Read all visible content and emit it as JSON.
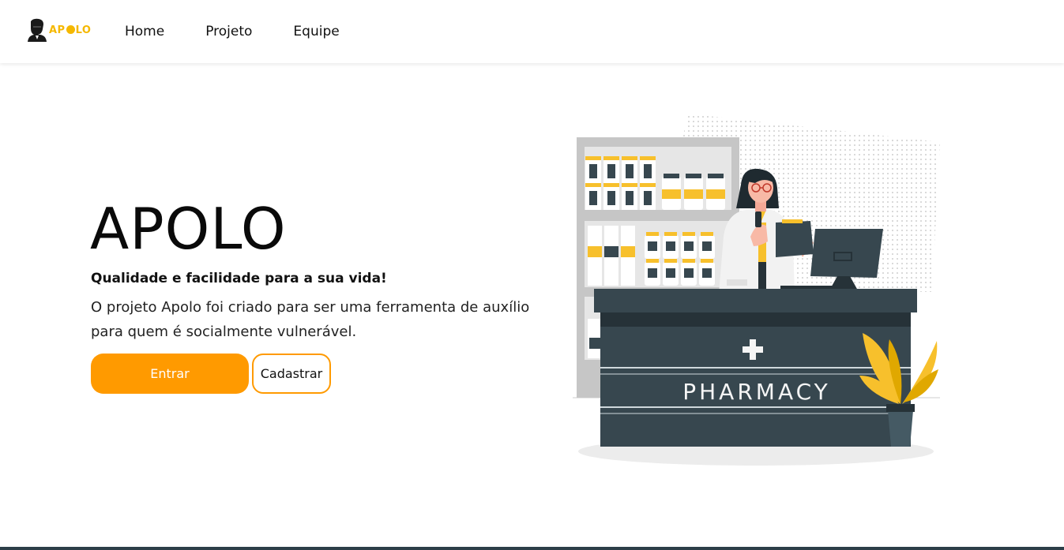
{
  "header": {
    "logo_text_a": "AP",
    "logo_text_b": "LO",
    "nav": [
      {
        "label": "Home"
      },
      {
        "label": "Projeto"
      },
      {
        "label": "Equipe"
      }
    ]
  },
  "hero": {
    "title": "APOLO",
    "subtitle": "Qualidade e facilidade para a sua vida!",
    "description": "O projeto Apolo foi criado para ser uma ferramenta de auxílio para quem é socialmente vulnerável.",
    "primary_button": "Entrar",
    "secondary_button": "Cadastrar"
  },
  "illustration": {
    "sign_text": "PHARMACY",
    "icons": [
      "pharmacist-icon",
      "shelf-icon",
      "plant-icon",
      "monitor-icon"
    ]
  },
  "colors": {
    "accent": "#ff9a00",
    "logo": "#f5b800",
    "counter": "#37474f",
    "bottle_yellow": "#f7c02c"
  }
}
